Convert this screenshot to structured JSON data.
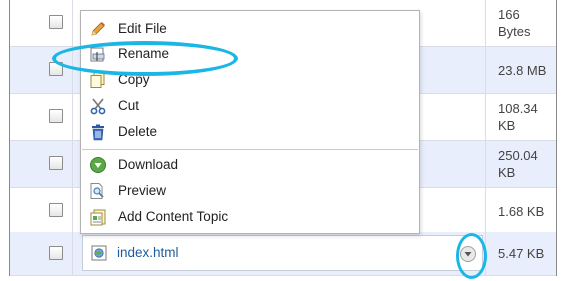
{
  "rows": [
    {
      "size": "166 Bytes"
    },
    {
      "size": "23.8 MB"
    },
    {
      "size": "108.34 KB"
    },
    {
      "size": "250.04 KB"
    },
    {
      "size": "1.68 KB"
    },
    {
      "size": "5.47 KB"
    }
  ],
  "context_menu": {
    "items": [
      {
        "label": "Edit File",
        "icon": "pencil-icon"
      },
      {
        "label": "Rename",
        "icon": "rename-icon"
      },
      {
        "label": "Copy",
        "icon": "copy-icon"
      },
      {
        "label": "Cut",
        "icon": "scissors-icon"
      },
      {
        "label": "Delete",
        "icon": "trash-icon"
      },
      {
        "label": "Download",
        "icon": "download-icon"
      },
      {
        "label": "Preview",
        "icon": "preview-icon"
      },
      {
        "label": "Add Content Topic",
        "icon": "content-topic-icon"
      }
    ]
  },
  "file": {
    "name": "index.html",
    "icon": "webpage-icon"
  },
  "colors": {
    "row_alt": "#e8eefb",
    "annotation": "#1ab7e6",
    "link": "#1f5b9c"
  }
}
